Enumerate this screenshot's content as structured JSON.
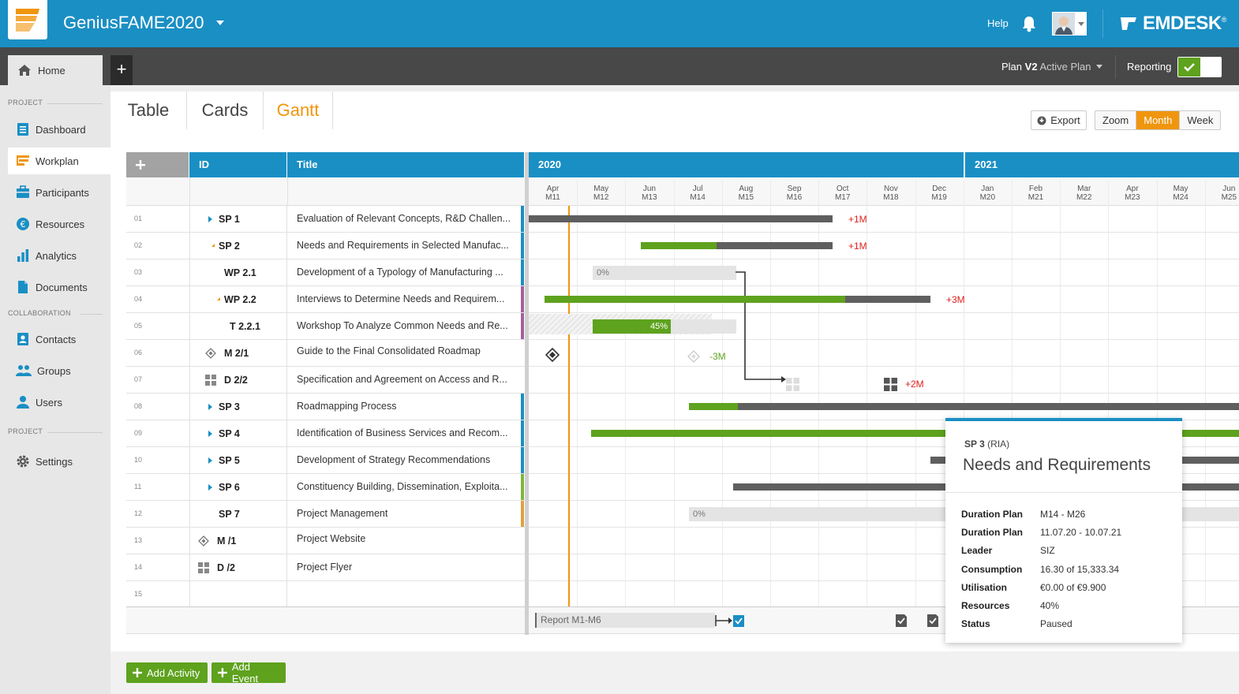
{
  "app": {
    "title": "GeniusFAME2020",
    "help": "Help",
    "brand": "EMDESK",
    "brand_mark": "®"
  },
  "subbar": {
    "home": "Home",
    "plan_prefix": "Plan",
    "plan_name": "V2",
    "plan_state": "Active Plan",
    "reporting": "Reporting"
  },
  "sidebar": {
    "sections": [
      "PROJECT",
      "COLLABORATION",
      "PROJECT"
    ],
    "items": [
      {
        "label": "Dashboard",
        "icon": "dashboard-icon"
      },
      {
        "label": "Workplan",
        "icon": "workplan-icon",
        "active": true
      },
      {
        "label": "Participants",
        "icon": "participants-icon"
      },
      {
        "label": "Resources",
        "icon": "euro-icon"
      },
      {
        "label": "Analytics",
        "icon": "bar-chart-icon"
      },
      {
        "label": "Documents",
        "icon": "document-icon"
      },
      {
        "label": "Contacts",
        "icon": "contacts-icon"
      },
      {
        "label": "Groups",
        "icon": "groups-icon"
      },
      {
        "label": "Users",
        "icon": "user-icon"
      },
      {
        "label": "Settings",
        "icon": "gear-icon"
      }
    ]
  },
  "views": {
    "tabs": [
      "Table",
      "Cards",
      "Gantt"
    ],
    "active": "Gantt"
  },
  "toolbar": {
    "export": "Export",
    "zoom": "Zoom",
    "month": "Month",
    "week": "Week",
    "active_scale": "Month"
  },
  "table": {
    "columns": {
      "id": "ID",
      "title": "Title"
    },
    "rows": [
      {
        "num": "01",
        "id": "SP 1",
        "title": "Evaluation of Relevant Concepts, R&D Challen...",
        "kind": "collapsed",
        "stripe": "#1a8fc4"
      },
      {
        "num": "02",
        "id": "SP 2",
        "title": "Needs and Requirements in Selected Manufac...",
        "kind": "expanded",
        "stripe": "#1a8fc4"
      },
      {
        "num": "03",
        "id": "WP 2.1",
        "title": "Development of a Typology of Manufacturing ...",
        "kind": "plain",
        "stripe": "#1a8fc4"
      },
      {
        "num": "04",
        "id": "WP 2.2",
        "title": "Interviews to Determine Needs and Requirem...",
        "kind": "expanded",
        "stripe": "#a45f9d"
      },
      {
        "num": "05",
        "id": "T 2.2.1",
        "title": "Workshop To Analyze Common Needs and Re...",
        "kind": "plain",
        "stripe": "#a45f9d"
      },
      {
        "num": "06",
        "id": "M 2/1",
        "title": "Guide to the Final Consolidated Roadmap",
        "kind": "milestone",
        "stripe": ""
      },
      {
        "num": "07",
        "id": "D 2/2",
        "title": "Specification and Agreement on Access and R...",
        "kind": "deliverable",
        "stripe": ""
      },
      {
        "num": "08",
        "id": "SP 3",
        "title": "Roadmapping Process",
        "kind": "collapsed",
        "stripe": "#1a8fc4"
      },
      {
        "num": "09",
        "id": "SP 4",
        "title": "Identification of Business Services and Recom...",
        "kind": "collapsed",
        "stripe": "#1a8fc4"
      },
      {
        "num": "10",
        "id": "SP 5",
        "title": "Development of Strategy Recommendations",
        "kind": "collapsed",
        "stripe": "#1a8fc4"
      },
      {
        "num": "11",
        "id": "SP 6",
        "title": "Constituency Building, Dissemination, Exploita...",
        "kind": "collapsed",
        "stripe": "#7fb53a"
      },
      {
        "num": "12",
        "id": "SP 7",
        "title": "Project Management",
        "kind": "plain",
        "stripe": "#e0a040"
      },
      {
        "num": "13",
        "id": "M /1",
        "title": "Project Website",
        "kind": "milestone",
        "stripe": ""
      },
      {
        "num": "14",
        "id": "D /2",
        "title": "Project Flyer",
        "kind": "deliverable",
        "stripe": ""
      },
      {
        "num": "15",
        "id": "",
        "title": "",
        "kind": "empty",
        "stripe": ""
      }
    ]
  },
  "gantt": {
    "years": [
      "2020",
      "2021"
    ],
    "months": [
      {
        "m": "Apr",
        "n": "M11"
      },
      {
        "m": "May",
        "n": "M12"
      },
      {
        "m": "Jun",
        "n": "M13"
      },
      {
        "m": "Jul",
        "n": "M14"
      },
      {
        "m": "Aug",
        "n": "M15"
      },
      {
        "m": "Sep",
        "n": "M16"
      },
      {
        "m": "Oct",
        "n": "M17"
      },
      {
        "m": "Nov",
        "n": "M18"
      },
      {
        "m": "Dec",
        "n": "M19"
      },
      {
        "m": "Jan",
        "n": "M20"
      },
      {
        "m": "Feb",
        "n": "M21"
      },
      {
        "m": "Mar",
        "n": "M22"
      },
      {
        "m": "Apr",
        "n": "M23"
      },
      {
        "m": "May",
        "n": "M24"
      },
      {
        "m": "Jun",
        "n": "M25"
      }
    ],
    "labels": {
      "wp21_progress": "0%",
      "t221_progress": "45%",
      "sp7_progress": "0%",
      "sp1_delay": "+1M",
      "sp2_delay": "+1M",
      "wp22_delay": "+3M",
      "m21_shift": "-3M",
      "d22_delay": "+2M",
      "report": "Report M1-M6"
    }
  },
  "tooltip": {
    "id": "SP 3",
    "type": "(RIA)",
    "title": "Needs and Requirements",
    "fields": [
      {
        "label": "Duration Plan",
        "value": "M14 - M26"
      },
      {
        "label": "Duration Plan",
        "value": "11.07.20 - 10.07.21"
      },
      {
        "label": "Leader",
        "value": "SIZ"
      },
      {
        "label": "Consumption",
        "value": "16.30 of 15,333.34"
      },
      {
        "label": "Utilisation",
        "value": "€0.00 of €9.900"
      },
      {
        "label": "Resources",
        "value": "40%"
      },
      {
        "label": "Status",
        "value": "Paused"
      }
    ]
  },
  "actions": {
    "add_activity": "Add Activity",
    "add_event": "Add Event"
  },
  "colors": {
    "accent": "#1a8fc4",
    "orange": "#f0960e",
    "green": "#5ea21e",
    "bar_grey": "#5f5f5f",
    "delay_red": "#e0201c"
  }
}
